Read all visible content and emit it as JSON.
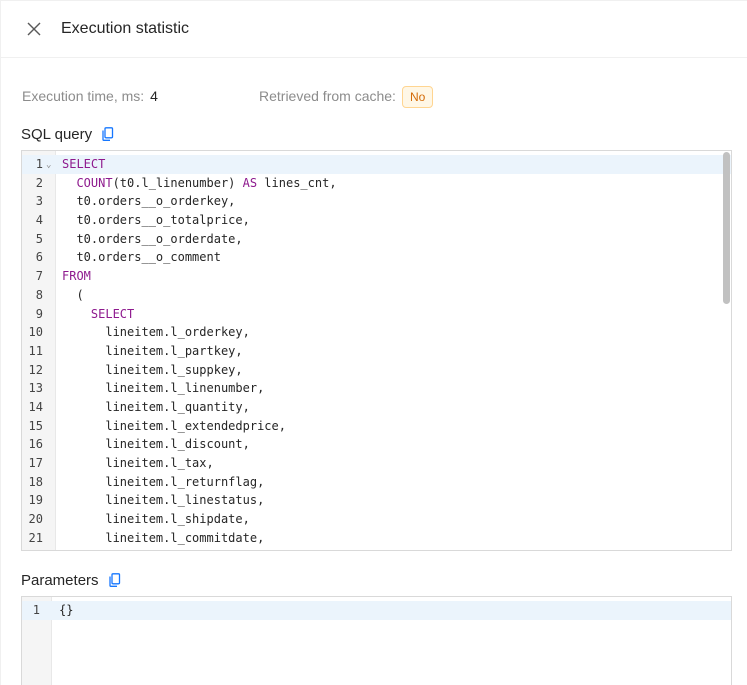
{
  "header": {
    "title": "Execution statistic",
    "close_icon": "close-icon"
  },
  "stats": {
    "execution_time_label": "Execution time, ms:",
    "execution_time_value": "4",
    "cache_label": "Retrieved from cache:",
    "cache_value": "No"
  },
  "sql_section": {
    "title": "SQL query",
    "copy_icon": "copy-icon",
    "lines": [
      {
        "n": "1",
        "indent": "",
        "kw": "SELECT",
        "text": ""
      },
      {
        "n": "2",
        "indent": "  ",
        "kw": "COUNT",
        "text": "(t0.l_linenumber) ",
        "kw2": "AS",
        "text2": " lines_cnt,"
      },
      {
        "n": "3",
        "indent": "  ",
        "kw": "",
        "text": "t0.orders__o_orderkey,"
      },
      {
        "n": "4",
        "indent": "  ",
        "kw": "",
        "text": "t0.orders__o_totalprice,"
      },
      {
        "n": "5",
        "indent": "  ",
        "kw": "",
        "text": "t0.orders__o_orderdate,"
      },
      {
        "n": "6",
        "indent": "  ",
        "kw": "",
        "text": "t0.orders__o_comment"
      },
      {
        "n": "7",
        "indent": "",
        "kw": "FROM",
        "text": ""
      },
      {
        "n": "8",
        "indent": "  ",
        "kw": "",
        "text": "("
      },
      {
        "n": "9",
        "indent": "    ",
        "kw": "SELECT",
        "text": ""
      },
      {
        "n": "10",
        "indent": "      ",
        "kw": "",
        "text": "lineitem.l_orderkey,"
      },
      {
        "n": "11",
        "indent": "      ",
        "kw": "",
        "text": "lineitem.l_partkey,"
      },
      {
        "n": "12",
        "indent": "      ",
        "kw": "",
        "text": "lineitem.l_suppkey,"
      },
      {
        "n": "13",
        "indent": "      ",
        "kw": "",
        "text": "lineitem.l_linenumber,"
      },
      {
        "n": "14",
        "indent": "      ",
        "kw": "",
        "text": "lineitem.l_quantity,"
      },
      {
        "n": "15",
        "indent": "      ",
        "kw": "",
        "text": "lineitem.l_extendedprice,"
      },
      {
        "n": "16",
        "indent": "      ",
        "kw": "",
        "text": "lineitem.l_discount,"
      },
      {
        "n": "17",
        "indent": "      ",
        "kw": "",
        "text": "lineitem.l_tax,"
      },
      {
        "n": "18",
        "indent": "      ",
        "kw": "",
        "text": "lineitem.l_returnflag,"
      },
      {
        "n": "19",
        "indent": "      ",
        "kw": "",
        "text": "lineitem.l_linestatus,"
      },
      {
        "n": "20",
        "indent": "      ",
        "kw": "",
        "text": "lineitem.l_shipdate,"
      },
      {
        "n": "21",
        "indent": "      ",
        "kw": "",
        "text": "lineitem.l_commitdate,"
      }
    ]
  },
  "params_section": {
    "title": "Parameters",
    "copy_icon": "copy-icon",
    "lines": [
      {
        "n": "1",
        "text": "{}"
      }
    ]
  },
  "colors": {
    "keyword": "#8e1a8e",
    "accent": "#1677ff",
    "badge_bg": "#fff7e6",
    "badge_text": "#d46b08",
    "active_line": "#ebf4fc"
  }
}
